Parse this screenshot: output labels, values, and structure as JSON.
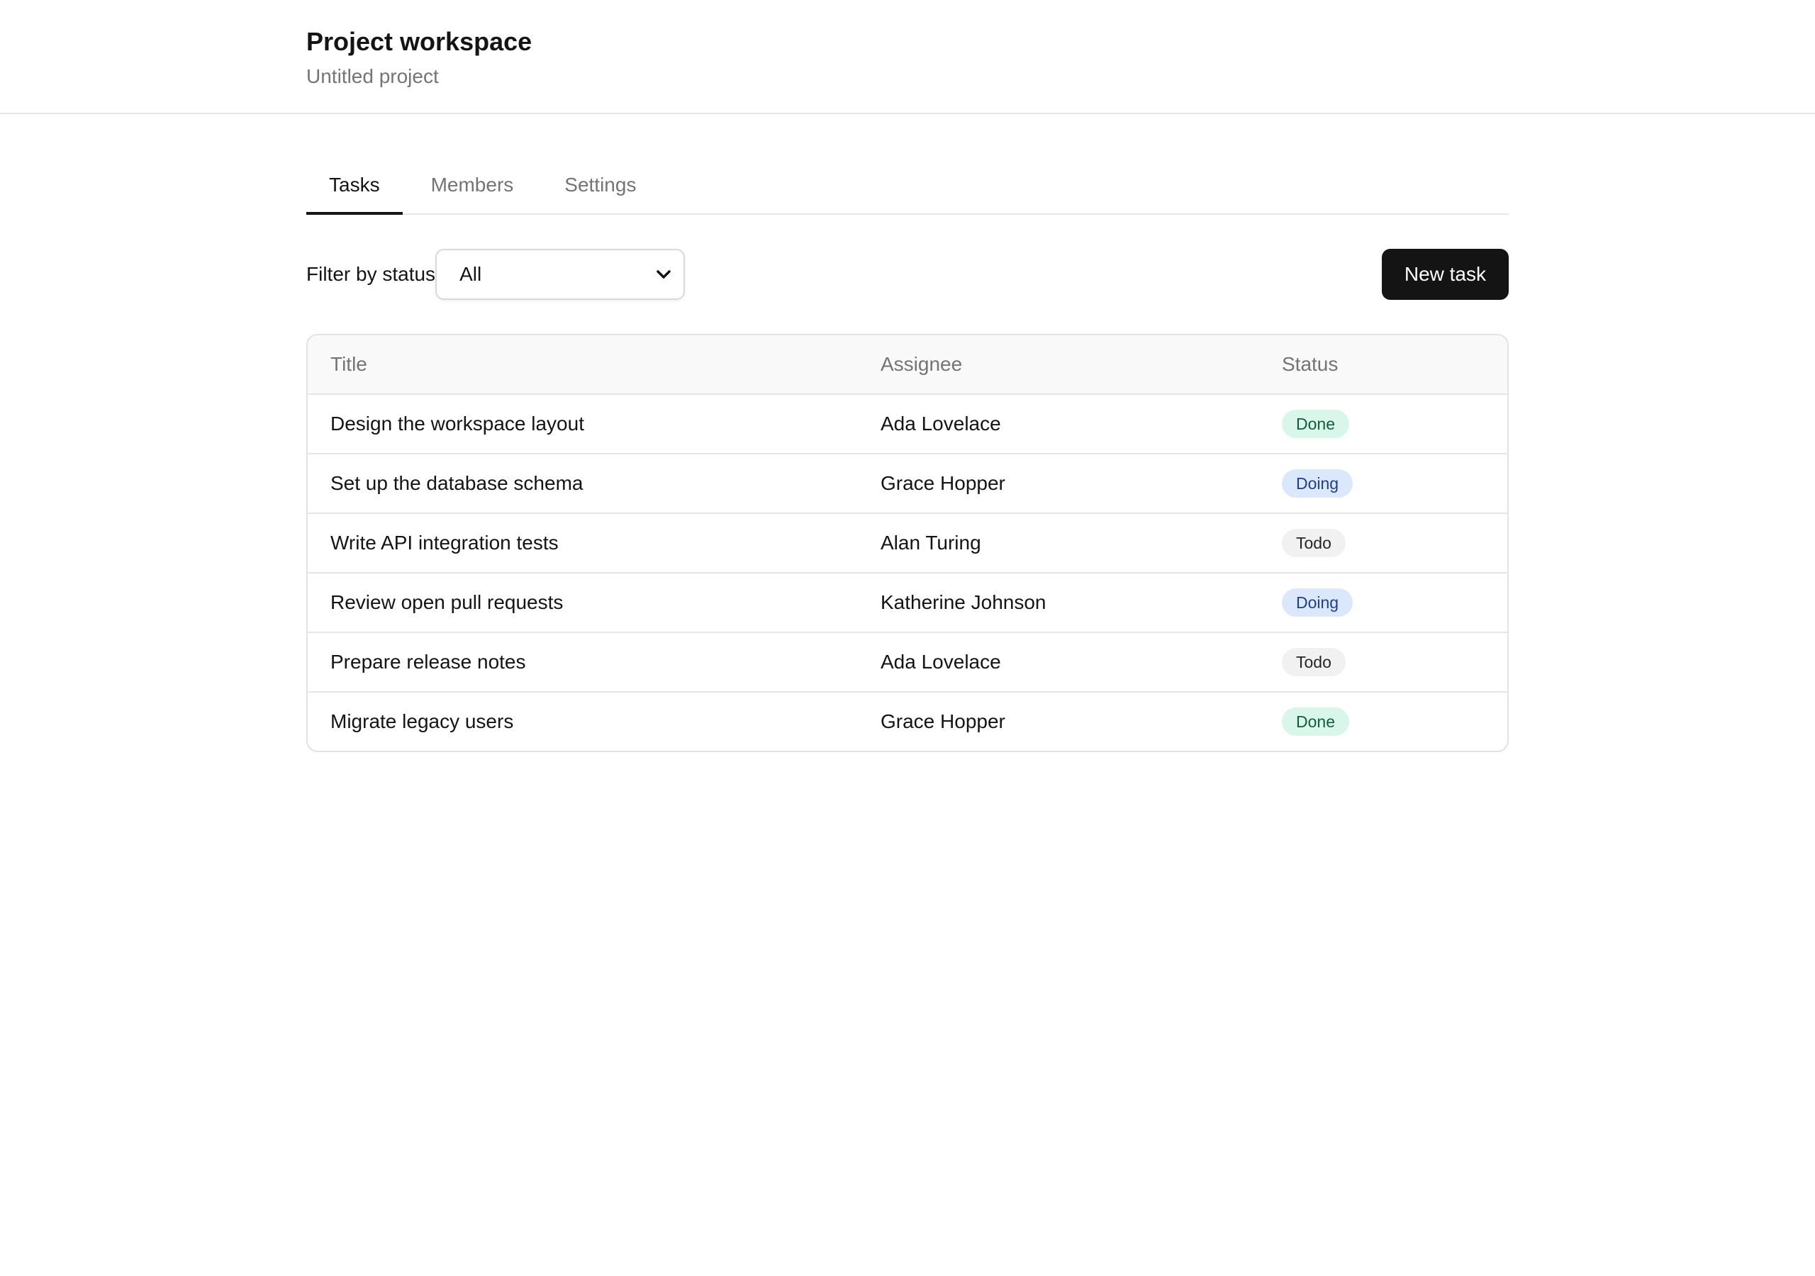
{
  "header": {
    "title": "Project workspace",
    "subtitle": "Untitled project"
  },
  "tabs": [
    {
      "label": "Tasks",
      "active": true
    },
    {
      "label": "Members",
      "active": false
    },
    {
      "label": "Settings",
      "active": false
    }
  ],
  "toolbar": {
    "filter_label": "Filter by status",
    "filter_value": "All",
    "new_task_label": "New task"
  },
  "table": {
    "columns": [
      "Title",
      "Assignee",
      "Status"
    ],
    "rows": [
      {
        "title": "Design the workspace layout",
        "assignee": "Ada Lovelace",
        "status": "Done"
      },
      {
        "title": "Set up the database schema",
        "assignee": "Grace Hopper",
        "status": "Doing"
      },
      {
        "title": "Write API integration tests",
        "assignee": "Alan Turing",
        "status": "Todo"
      },
      {
        "title": "Review open pull requests",
        "assignee": "Katherine Johnson",
        "status": "Doing"
      },
      {
        "title": "Prepare release notes",
        "assignee": "Ada Lovelace",
        "status": "Todo"
      },
      {
        "title": "Migrate legacy users",
        "assignee": "Grace Hopper",
        "status": "Done"
      }
    ]
  },
  "colors": {
    "primary": "#141414",
    "done_bg": "#d9f6ea",
    "doing_bg": "#dbe8fb",
    "todo_bg": "#f1f1f1"
  },
  "icons": {
    "select_chevron": "chevron-down-icon"
  }
}
